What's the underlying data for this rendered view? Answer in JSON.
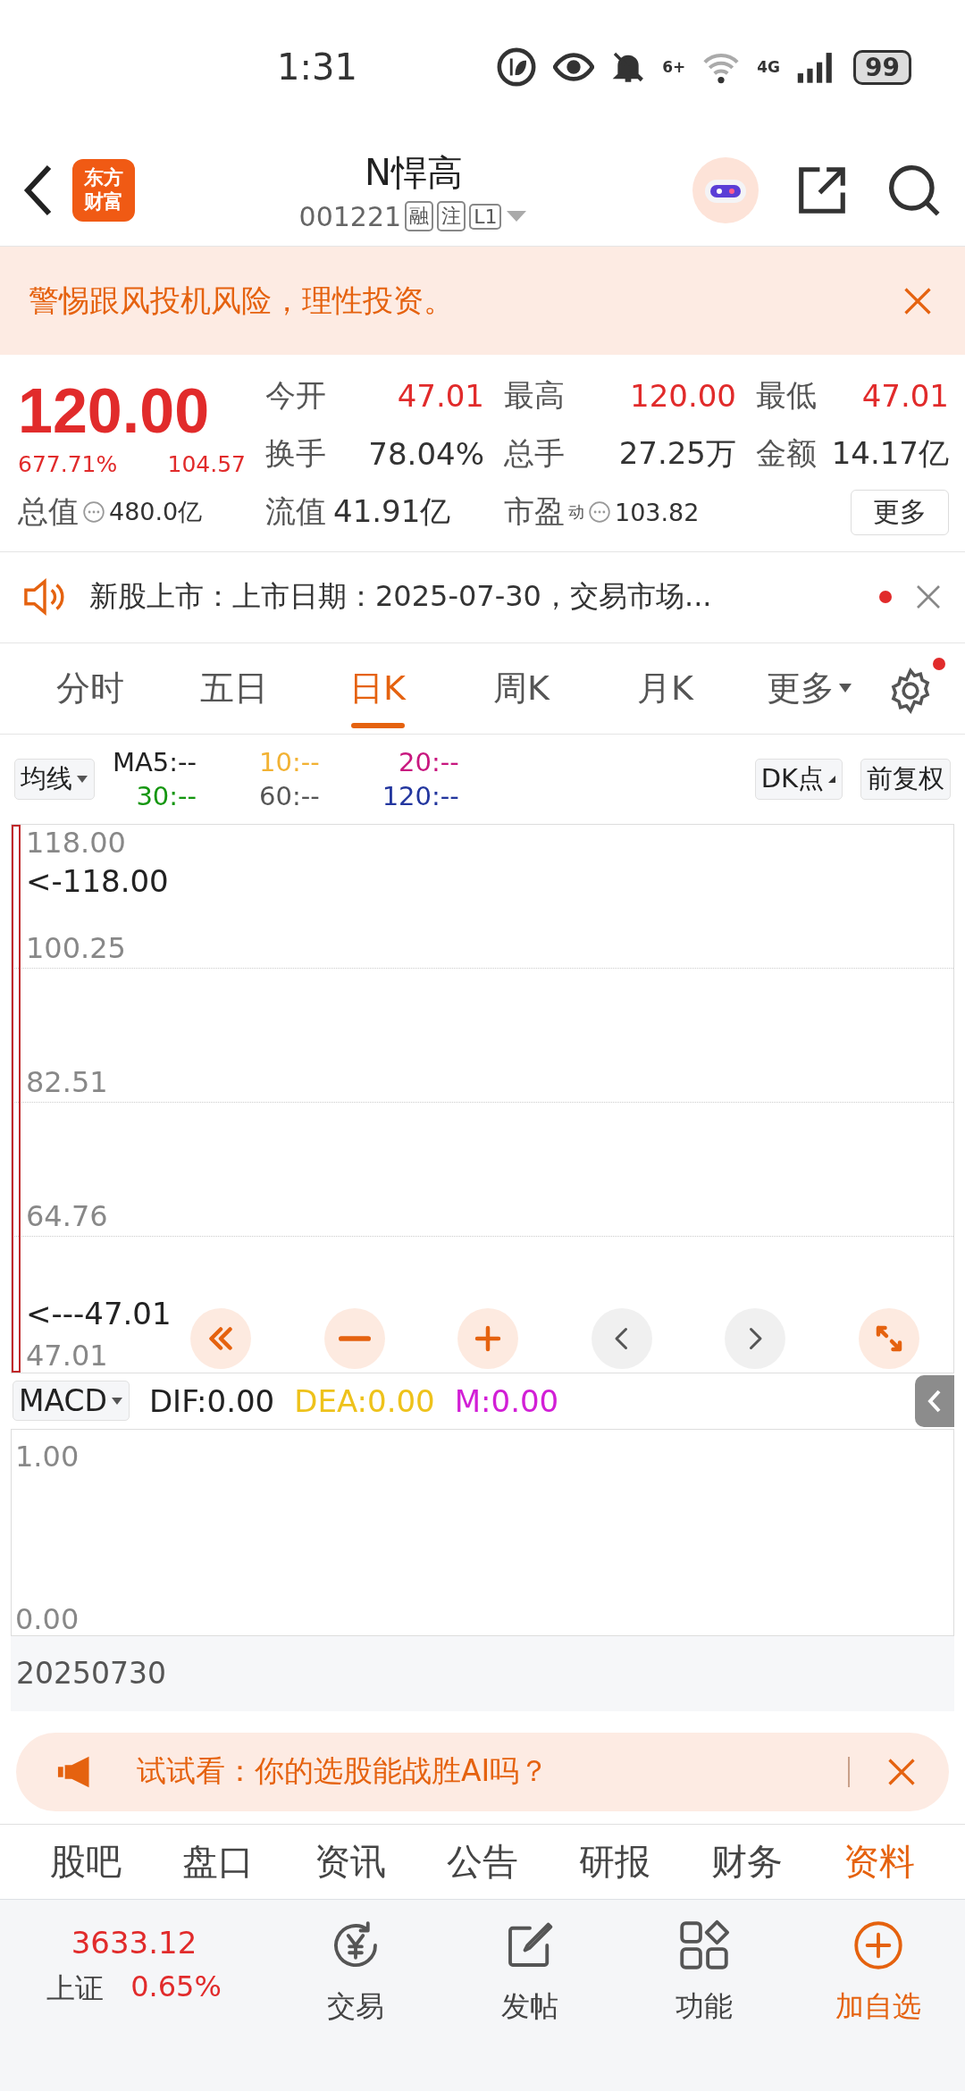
{
  "status_bar": {
    "time": "1:31",
    "wifi_label": "6+",
    "network": "4G",
    "battery": "99"
  },
  "header": {
    "logo": [
      "东方",
      "财富"
    ],
    "title": "N悍高",
    "code": "001221",
    "badges": [
      "融",
      "注",
      "L1"
    ]
  },
  "risk_banner": {
    "text": "警惕跟风投机风险，理性投资。"
  },
  "quote": {
    "price": "120.00",
    "change_percent": "677.71%",
    "change": "104.57",
    "rising": true,
    "stats": [
      {
        "label": "今开",
        "value": "47.01",
        "rising": true
      },
      {
        "label": "最高",
        "value": "120.00",
        "rising": true
      },
      {
        "label": "最低",
        "value": "47.01",
        "rising": true
      },
      {
        "label": "换手",
        "value": "78.04%",
        "rising": false
      },
      {
        "label": "总手",
        "value": "27.25万",
        "rising": false
      },
      {
        "label": "金额",
        "value": "14.17亿",
        "rising": false
      }
    ],
    "market_cap": {
      "label": "总值",
      "value": "480.0亿"
    },
    "float_cap": {
      "label": "流值",
      "value": "41.91亿"
    },
    "pe": {
      "label": "市盈",
      "superscript": "动",
      "value": "103.82"
    },
    "more_button": "更多"
  },
  "news": {
    "text": "新股上市：上市日期：2025-07-30，交易市场...",
    "unread": true
  },
  "period_tabs": [
    {
      "label": "分时",
      "selected": false,
      "kind": "plain"
    },
    {
      "label": "五日",
      "selected": false,
      "kind": "plain"
    },
    {
      "label": "日K",
      "selected": true,
      "kind": "plain"
    },
    {
      "label": "周K",
      "selected": false,
      "kind": "plain"
    },
    {
      "label": "月K",
      "selected": false,
      "kind": "plain"
    },
    {
      "label": "更多",
      "selected": false,
      "kind": "dropdown"
    }
  ],
  "settings_badge": true,
  "ma_bar": {
    "selector": "均线",
    "items": [
      {
        "label": "MA5:--",
        "color": "#222222"
      },
      {
        "label": "10:--",
        "color": "#f2b233"
      },
      {
        "label": "20:--",
        "color": "#c8177f"
      },
      {
        "label": "30:--",
        "color": "#14960f"
      },
      {
        "label": "60:--",
        "color": "#555555"
      },
      {
        "label": "120:--",
        "color": "#23369e"
      }
    ],
    "dk_button": "DK点",
    "adjust_button": "前复权"
  },
  "kline": {
    "yticks": [
      "118.00",
      "100.25",
      "82.51",
      "64.76",
      "47.01"
    ],
    "high_marker": "<-118.00",
    "low_marker": "<---47.01",
    "controls": [
      {
        "kind": "rewind"
      },
      {
        "kind": "zoom-out"
      },
      {
        "kind": "zoom-in"
      },
      {
        "kind": "prev"
      },
      {
        "kind": "next"
      },
      {
        "kind": "fullscreen"
      }
    ]
  },
  "macd": {
    "selector": "MACD",
    "items": [
      {
        "label": "DIF:0.00",
        "color": "#222222"
      },
      {
        "label": "DEA:0.00",
        "color": "#eec21b"
      },
      {
        "label": "M:0.00",
        "color": "#d21fd6"
      }
    ],
    "yticks": [
      "1.00",
      "0.00"
    ]
  },
  "date": "20250730",
  "ai_banner": {
    "text": "试试看：你的选股能战胜AI吗？"
  },
  "info_tabs": [
    {
      "label": "股吧",
      "selected": false
    },
    {
      "label": "盘口",
      "selected": false
    },
    {
      "label": "资讯",
      "selected": false
    },
    {
      "label": "公告",
      "selected": false
    },
    {
      "label": "研报",
      "selected": false
    },
    {
      "label": "财务",
      "selected": false
    },
    {
      "label": "资料",
      "selected": true
    }
  ],
  "bottom_nav": {
    "index": {
      "value": "3633.12",
      "name": "上证",
      "change": "0.65%"
    },
    "items": [
      {
        "label": "交易",
        "kind": "trade"
      },
      {
        "label": "发帖",
        "kind": "post"
      },
      {
        "label": "功能",
        "kind": "apps"
      },
      {
        "label": "加自选",
        "kind": "add"
      }
    ]
  }
}
